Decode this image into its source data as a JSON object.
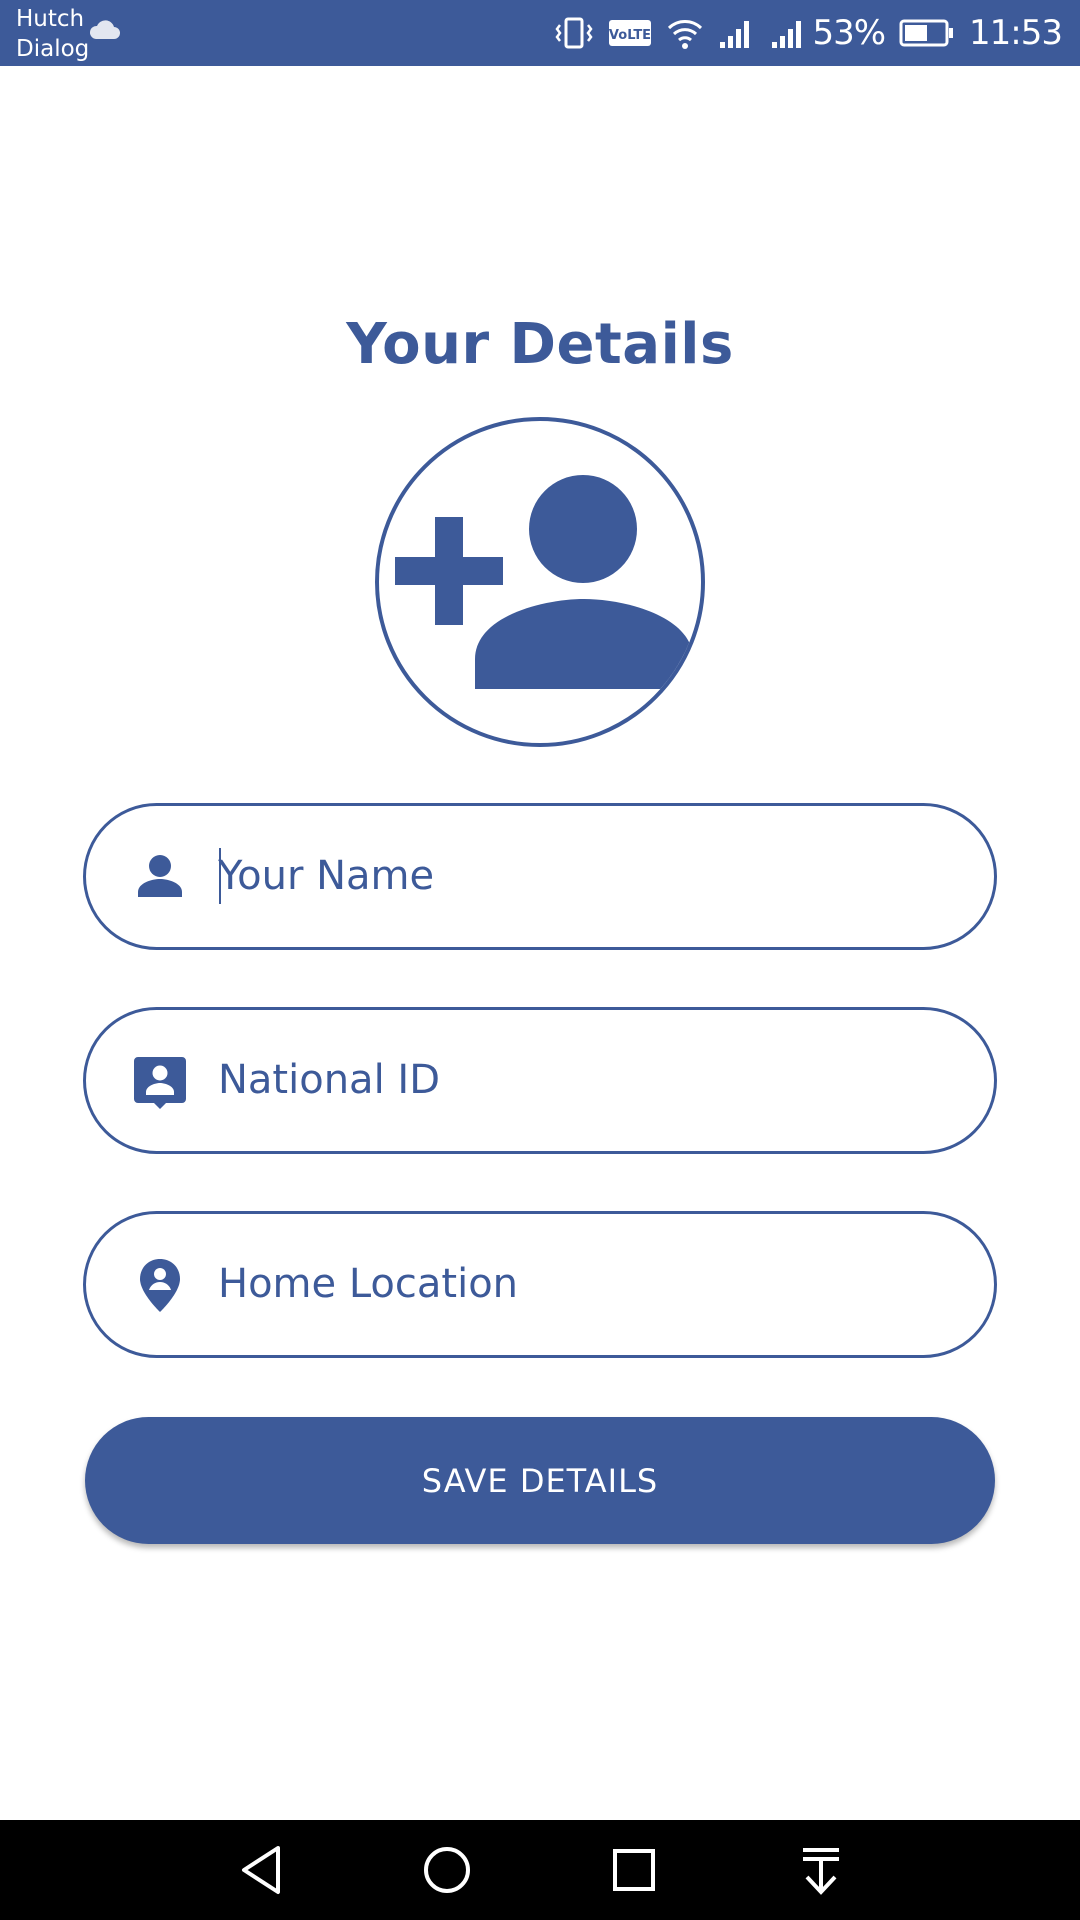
{
  "status_bar": {
    "carrier_1": "Hutch",
    "carrier_2": "Dialog",
    "volte_label": "VoLTE",
    "battery_percent": "53%",
    "time": "11:53"
  },
  "page": {
    "title": "Your Details"
  },
  "form": {
    "name_placeholder": "Your Name",
    "national_id_placeholder": "National ID",
    "home_location_placeholder": "Home Location",
    "save_label": "SAVE DETAILS"
  },
  "icons": {
    "avatar": "add-user-icon",
    "name": "person-icon",
    "national_id": "contact-card-icon",
    "home_location": "location-pin-icon",
    "nav_back": "back-triangle-icon",
    "nav_home": "home-circle-icon",
    "nav_recents": "recents-square-icon",
    "nav_notifications": "pull-down-icon"
  },
  "colors": {
    "primary": "#3d5a99",
    "background": "#ffffff",
    "nav_bar": "#000000"
  }
}
